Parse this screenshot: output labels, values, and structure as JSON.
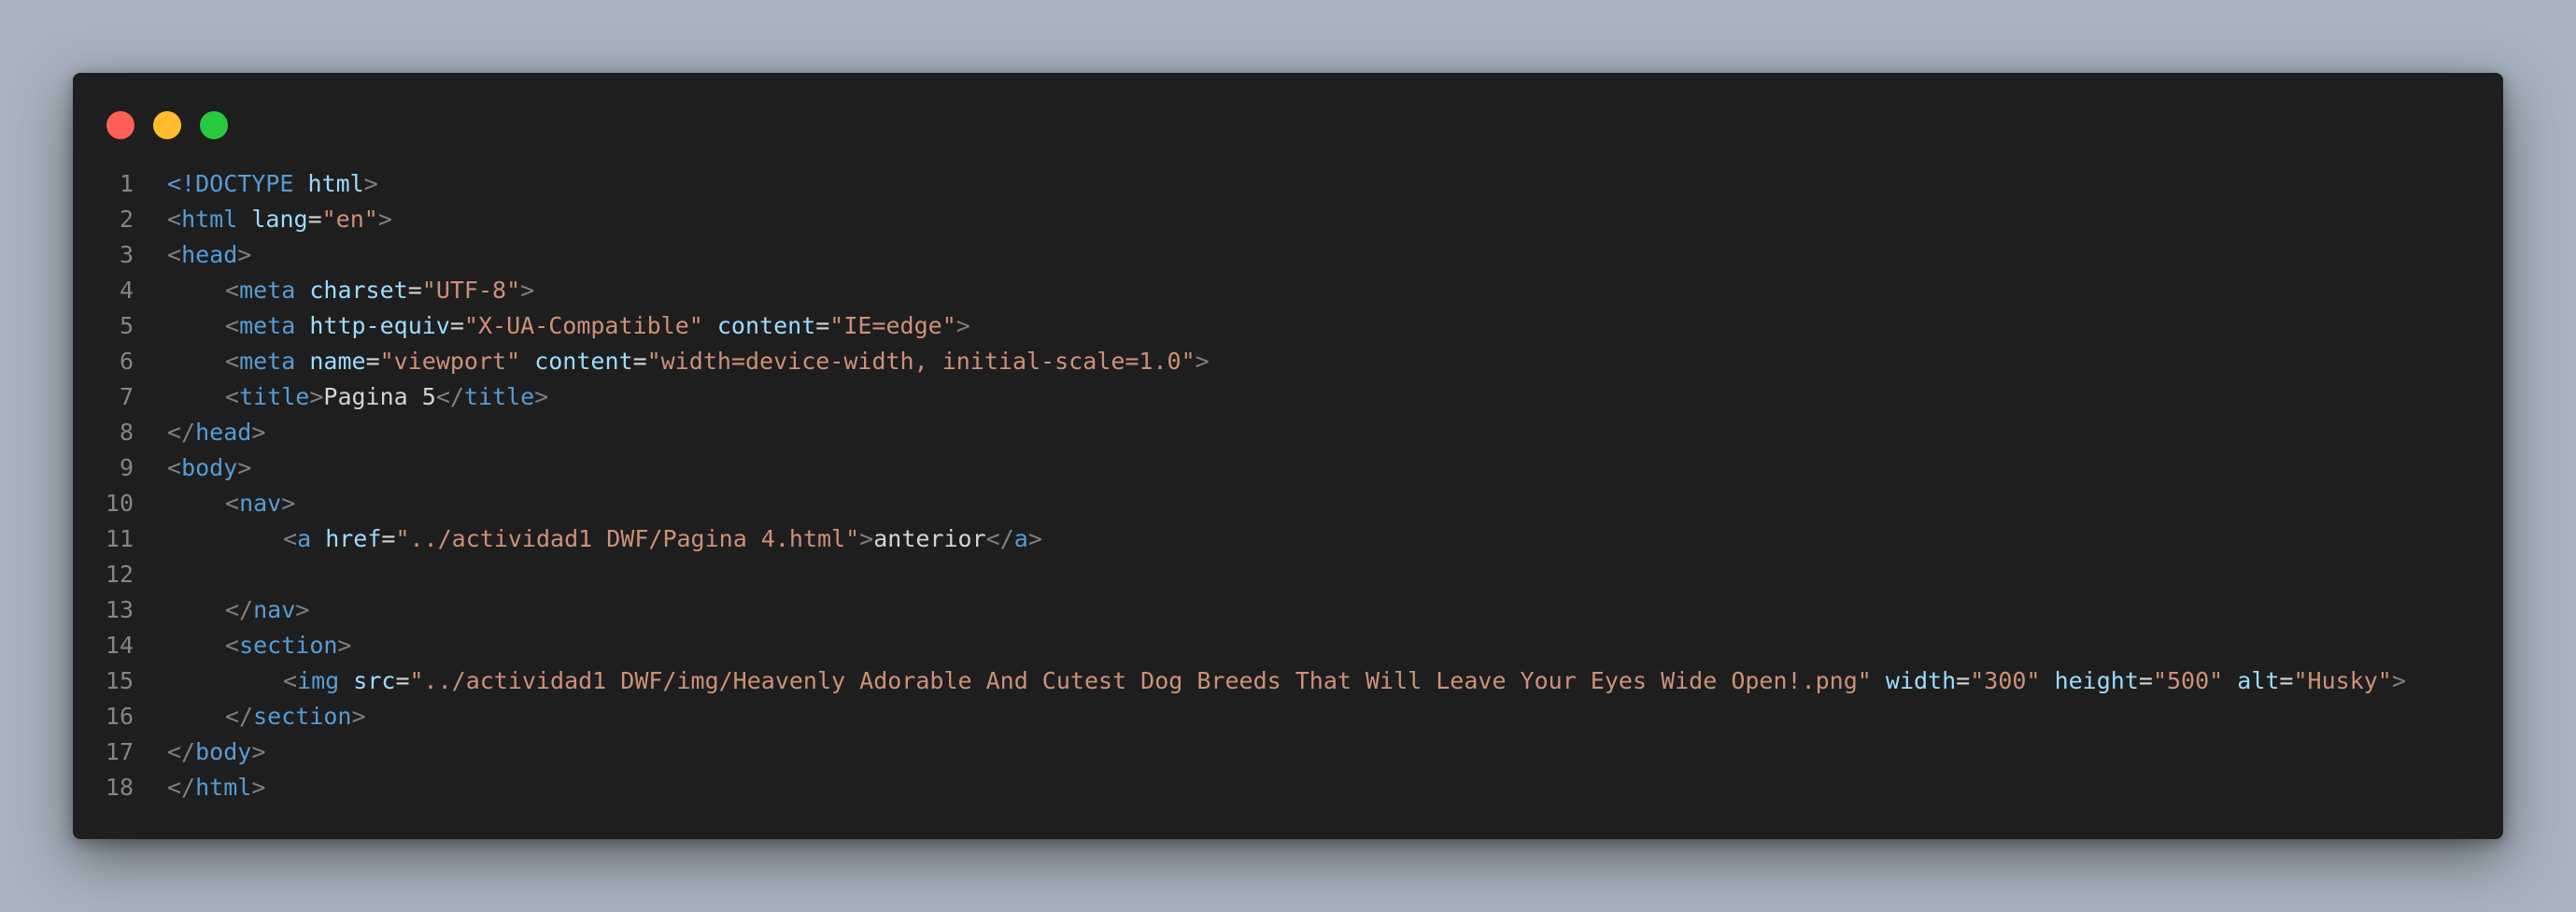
{
  "colors": {
    "background": "#a7b3bf",
    "editor": "#1e1e1e",
    "line_number": "#858585",
    "punct": "#808080",
    "tag": "#569cd6",
    "attr": "#9cdcfe",
    "string": "#ce9178",
    "text": "#d4d4d4",
    "close_dot": "#ff5f56",
    "minimize_dot": "#ffbd2e",
    "maximize_dot": "#27c93f"
  },
  "lines": [
    {
      "num": "1",
      "indent": 0,
      "tokens": [
        {
          "t": "<!DOCTYPE",
          "c": "tag-punct"
        },
        {
          "t": " ",
          "c": "text"
        },
        {
          "t": "html",
          "c": "attr"
        },
        {
          "t": ">",
          "c": "punct"
        }
      ]
    },
    {
      "num": "2",
      "indent": 0,
      "tokens": [
        {
          "t": "<",
          "c": "punct"
        },
        {
          "t": "html",
          "c": "tag"
        },
        {
          "t": " ",
          "c": "text"
        },
        {
          "t": "lang",
          "c": "attr"
        },
        {
          "t": "=",
          "c": "text"
        },
        {
          "t": "\"en\"",
          "c": "string"
        },
        {
          "t": ">",
          "c": "punct"
        }
      ]
    },
    {
      "num": "3",
      "indent": 0,
      "tokens": [
        {
          "t": "<",
          "c": "punct"
        },
        {
          "t": "head",
          "c": "tag"
        },
        {
          "t": ">",
          "c": "punct"
        }
      ]
    },
    {
      "num": "4",
      "indent": 1,
      "tokens": [
        {
          "t": "<",
          "c": "punct"
        },
        {
          "t": "meta",
          "c": "tag"
        },
        {
          "t": " ",
          "c": "text"
        },
        {
          "t": "charset",
          "c": "attr"
        },
        {
          "t": "=",
          "c": "text"
        },
        {
          "t": "\"UTF-8\"",
          "c": "string"
        },
        {
          "t": ">",
          "c": "punct"
        }
      ]
    },
    {
      "num": "5",
      "indent": 1,
      "tokens": [
        {
          "t": "<",
          "c": "punct"
        },
        {
          "t": "meta",
          "c": "tag"
        },
        {
          "t": " ",
          "c": "text"
        },
        {
          "t": "http-equiv",
          "c": "attr"
        },
        {
          "t": "=",
          "c": "text"
        },
        {
          "t": "\"X-UA-Compatible\"",
          "c": "string"
        },
        {
          "t": " ",
          "c": "text"
        },
        {
          "t": "content",
          "c": "attr"
        },
        {
          "t": "=",
          "c": "text"
        },
        {
          "t": "\"IE=edge\"",
          "c": "string"
        },
        {
          "t": ">",
          "c": "punct"
        }
      ]
    },
    {
      "num": "6",
      "indent": 1,
      "tokens": [
        {
          "t": "<",
          "c": "punct"
        },
        {
          "t": "meta",
          "c": "tag"
        },
        {
          "t": " ",
          "c": "text"
        },
        {
          "t": "name",
          "c": "attr"
        },
        {
          "t": "=",
          "c": "text"
        },
        {
          "t": "\"viewport\"",
          "c": "string"
        },
        {
          "t": " ",
          "c": "text"
        },
        {
          "t": "content",
          "c": "attr"
        },
        {
          "t": "=",
          "c": "text"
        },
        {
          "t": "\"width=device-width, initial-scale=1.0\"",
          "c": "string"
        },
        {
          "t": ">",
          "c": "punct"
        }
      ]
    },
    {
      "num": "7",
      "indent": 1,
      "tokens": [
        {
          "t": "<",
          "c": "punct"
        },
        {
          "t": "title",
          "c": "tag"
        },
        {
          "t": ">",
          "c": "punct"
        },
        {
          "t": "Pagina 5",
          "c": "plain"
        },
        {
          "t": "</",
          "c": "punct"
        },
        {
          "t": "title",
          "c": "tag"
        },
        {
          "t": ">",
          "c": "punct"
        }
      ]
    },
    {
      "num": "8",
      "indent": 0,
      "tokens": [
        {
          "t": "</",
          "c": "punct"
        },
        {
          "t": "head",
          "c": "tag"
        },
        {
          "t": ">",
          "c": "punct"
        }
      ]
    },
    {
      "num": "9",
      "indent": 0,
      "tokens": [
        {
          "t": "<",
          "c": "punct"
        },
        {
          "t": "body",
          "c": "tag"
        },
        {
          "t": ">",
          "c": "punct"
        }
      ]
    },
    {
      "num": "10",
      "indent": 1,
      "tokens": [
        {
          "t": "<",
          "c": "punct"
        },
        {
          "t": "nav",
          "c": "tag"
        },
        {
          "t": ">",
          "c": "punct"
        }
      ]
    },
    {
      "num": "11",
      "indent": 2,
      "tokens": [
        {
          "t": "<",
          "c": "punct"
        },
        {
          "t": "a",
          "c": "tag"
        },
        {
          "t": " ",
          "c": "text"
        },
        {
          "t": "href",
          "c": "attr"
        },
        {
          "t": "=",
          "c": "text"
        },
        {
          "t": "\"../actividad1 DWF/Pagina 4.html\"",
          "c": "string"
        },
        {
          "t": ">",
          "c": "punct"
        },
        {
          "t": "anterior",
          "c": "plain"
        },
        {
          "t": "</",
          "c": "punct"
        },
        {
          "t": "a",
          "c": "tag"
        },
        {
          "t": ">",
          "c": "punct"
        }
      ]
    },
    {
      "num": "12",
      "indent": 0,
      "tokens": []
    },
    {
      "num": "13",
      "indent": 1,
      "tokens": [
        {
          "t": "</",
          "c": "punct"
        },
        {
          "t": "nav",
          "c": "tag"
        },
        {
          "t": ">",
          "c": "punct"
        }
      ]
    },
    {
      "num": "14",
      "indent": 1,
      "tokens": [
        {
          "t": "<",
          "c": "punct"
        },
        {
          "t": "section",
          "c": "tag"
        },
        {
          "t": ">",
          "c": "punct"
        }
      ]
    },
    {
      "num": "15",
      "indent": 2,
      "tokens": [
        {
          "t": "<",
          "c": "punct"
        },
        {
          "t": "img",
          "c": "tag"
        },
        {
          "t": " ",
          "c": "text"
        },
        {
          "t": "src",
          "c": "attr"
        },
        {
          "t": "=",
          "c": "text"
        },
        {
          "t": "\"../actividad1 DWF/img/Heavenly Adorable And Cutest Dog Breeds That Will Leave Your Eyes Wide Open!.png\"",
          "c": "string"
        },
        {
          "t": " ",
          "c": "text"
        },
        {
          "t": "width",
          "c": "attr"
        },
        {
          "t": "=",
          "c": "text"
        },
        {
          "t": "\"300\"",
          "c": "string"
        },
        {
          "t": " ",
          "c": "text"
        },
        {
          "t": "height",
          "c": "attr"
        },
        {
          "t": "=",
          "c": "text"
        },
        {
          "t": "\"500\"",
          "c": "string"
        },
        {
          "t": " ",
          "c": "text"
        },
        {
          "t": "alt",
          "c": "attr"
        },
        {
          "t": "=",
          "c": "text"
        },
        {
          "t": "\"Husky\"",
          "c": "string"
        },
        {
          "t": ">",
          "c": "punct"
        }
      ]
    },
    {
      "num": "16",
      "indent": 1,
      "tokens": [
        {
          "t": "</",
          "c": "punct"
        },
        {
          "t": "section",
          "c": "tag"
        },
        {
          "t": ">",
          "c": "punct"
        }
      ]
    },
    {
      "num": "17",
      "indent": 0,
      "tokens": [
        {
          "t": "</",
          "c": "punct"
        },
        {
          "t": "body",
          "c": "tag"
        },
        {
          "t": ">",
          "c": "punct"
        }
      ]
    },
    {
      "num": "18",
      "indent": 0,
      "tokens": [
        {
          "t": "</",
          "c": "punct"
        },
        {
          "t": "html",
          "c": "tag"
        },
        {
          "t": ">",
          "c": "punct"
        }
      ]
    }
  ]
}
